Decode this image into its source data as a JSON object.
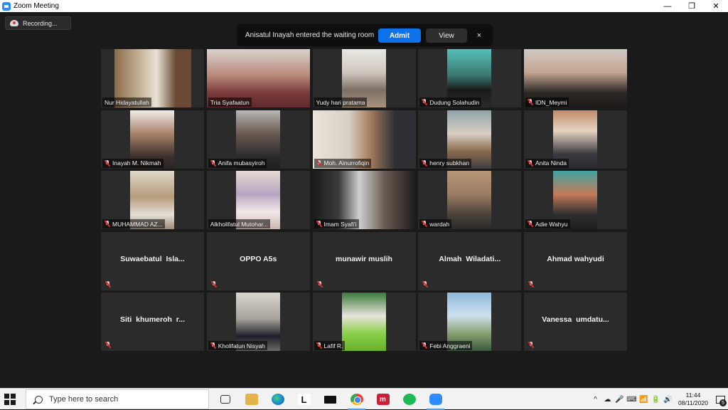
{
  "window": {
    "title": "Zoom Meeting",
    "controls": [
      "—",
      "❐",
      "✕"
    ]
  },
  "recording": {
    "label": "Recording..."
  },
  "waiting_room": {
    "message": "Anisatul Inayah entered the waiting room",
    "admit_label": "Admit",
    "view_label": "View",
    "close_label": "×"
  },
  "participants": [
    {
      "name": "Nur Hidayatullah",
      "video": true,
      "muted": false
    },
    {
      "name": "Tria Syafaatun",
      "video": true,
      "muted": false,
      "active_speaker": true
    },
    {
      "name": "Yudy hari pratama",
      "video": true,
      "muted": false
    },
    {
      "name": "Dudung Solahudin",
      "video": true,
      "muted": true
    },
    {
      "name": "IDN_Meymi",
      "video": true,
      "muted": true
    },
    {
      "name": "Inayah M. Nikmah",
      "video": true,
      "muted": true
    },
    {
      "name": "Anifa mubasyiroh",
      "video": true,
      "muted": true
    },
    {
      "name": "Moh. Ainurrofiqin",
      "video": true,
      "muted": true
    },
    {
      "name": "henry subkhan",
      "video": true,
      "muted": true
    },
    {
      "name": "Anita Ninda",
      "video": true,
      "muted": true
    },
    {
      "name": "MUHAMMAD AZ...",
      "video": true,
      "muted": true
    },
    {
      "name": "Alkholifatul Mutohar...",
      "video": true,
      "muted": false
    },
    {
      "name": "Imam Syafi'i",
      "video": true,
      "muted": true
    },
    {
      "name": "wardah",
      "video": true,
      "muted": true
    },
    {
      "name": "Adie Wahyu",
      "video": true,
      "muted": true
    },
    {
      "name": "Suwaebatul  Isla...",
      "video": false,
      "muted": true
    },
    {
      "name": "OPPO A5s",
      "video": false,
      "muted": true
    },
    {
      "name": "munawir muslih",
      "video": false,
      "muted": true
    },
    {
      "name": "Almah  Wiladati...",
      "video": false,
      "muted": true
    },
    {
      "name": "Ahmad wahyudi",
      "video": false,
      "muted": true
    },
    {
      "name": "Siti  khumeroh  r...",
      "video": false,
      "muted": true
    },
    {
      "name": "Kholifatun Nisyah",
      "video": true,
      "muted": true
    },
    {
      "name": "Lafif R.",
      "video": true,
      "muted": true
    },
    {
      "name": "Febi Anggraeni",
      "video": true,
      "muted": true
    },
    {
      "name": "Vanessa  umdatu...",
      "video": false,
      "muted": true
    }
  ],
  "taskbar": {
    "search_placeholder": "Type here to search",
    "apps": [
      "task-view",
      "file-explorer",
      "edge",
      "L",
      "mail",
      "chrome",
      "m",
      "spotify",
      "zoom"
    ],
    "app_letters": {
      "l": "L",
      "m": "m"
    },
    "tray_icons": [
      "^",
      "☁",
      "🎤",
      "⌨",
      "📶",
      "🔋",
      "🔊"
    ],
    "time": "11:44",
    "date": "08/11/2020",
    "notification_count": "5"
  },
  "colors": {
    "accent": "#0e72ed",
    "active_speaker": "#d9e021",
    "background": "#1a1a1a"
  }
}
